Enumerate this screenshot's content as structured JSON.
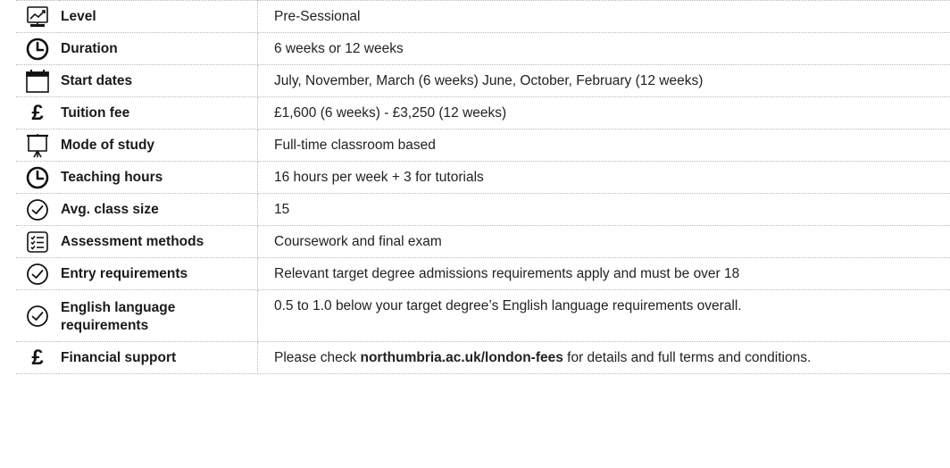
{
  "rows": [
    {
      "icon": "chart-monitor-icon",
      "label": "Level",
      "value": "Pre-Sessional"
    },
    {
      "icon": "clock-icon",
      "label": "Duration",
      "value": "6 weeks or 12 weeks"
    },
    {
      "icon": "calendar-icon",
      "label": "Start dates",
      "value": "July, November, March (6 weeks) June, October, February (12 weeks)"
    },
    {
      "icon": "pound-icon",
      "label": "Tuition fee",
      "value": "£1,600 (6 weeks) - £3,250 (12 weeks)"
    },
    {
      "icon": "presentation-board-icon",
      "label": "Mode of study",
      "value": "Full-time classroom based"
    },
    {
      "icon": "clock-icon",
      "label": "Teaching hours",
      "value": "16 hours per week + 3 for tutorials"
    },
    {
      "icon": "check-circle-icon",
      "label": "Avg. class size",
      "value": "15"
    },
    {
      "icon": "checklist-icon",
      "label": "Assessment methods",
      "value": "Coursework and final exam"
    },
    {
      "icon": "check-circle-icon",
      "label": "Entry requirements",
      "value": "Relevant target degree admissions requirements apply and must be over 18"
    },
    {
      "icon": "check-circle-icon",
      "label": "English language requirements",
      "value": "0.5 to 1.0 below your target degree’s English language requirements overall."
    },
    {
      "icon": "pound-icon",
      "label": "Financial support",
      "value_prefix": "Please check ",
      "value_link": "northumbria.ac.uk/london-fees",
      "value_suffix": " for details and full terms and conditions."
    }
  ],
  "pound_symbol": "£"
}
